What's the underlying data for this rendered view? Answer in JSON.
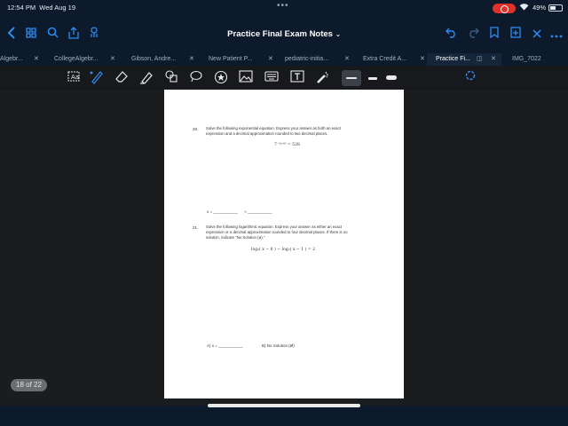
{
  "status": {
    "time": "12:54 PM",
    "date": "Wed Aug 19",
    "battery_pct": "49%",
    "battery_level": 0.49,
    "recording": true
  },
  "navbar": {
    "title": "Practice Final Exam Notes",
    "left_icons": [
      "back-icon",
      "grid-icon",
      "search-icon",
      "share-icon",
      "bookmark-tag-icon"
    ],
    "right_icons": [
      "undo-icon",
      "redo-icon",
      "bookmark-icon",
      "export-icon",
      "close-icon",
      "more-icon"
    ]
  },
  "tabs": [
    {
      "label": "Algebr...",
      "active": false
    },
    {
      "label": "CollegeAlgebr...",
      "active": false
    },
    {
      "label": "Gibson, Andre...",
      "active": false
    },
    {
      "label": "New Patient P...",
      "active": false
    },
    {
      "label": "pediatric-initia...",
      "active": false
    },
    {
      "label": "Extra Credit A...",
      "active": false
    },
    {
      "label": "Practice Fi...",
      "active": true
    },
    {
      "label": "IMG_7022",
      "active": false
    }
  ],
  "toolbar": {
    "tools": [
      "lasso-text-icon",
      "pen-icon",
      "eraser-icon",
      "highlighter-icon",
      "shapes-icon",
      "lasso-icon",
      "sticker-icon",
      "image-icon",
      "keyboard-icon",
      "text-icon",
      "laser-pointer-icon"
    ],
    "selected_tool": "pen-icon",
    "accent": "#2d8cf0"
  },
  "page": {
    "q20": {
      "number": "20.",
      "text_line1": "Solve the following exponential equation.  Express your answer as both an exact",
      "text_line2": "expression and a decimal approximation rounded to two decimal places.",
      "equation": "7⁻³ˣ⁺⁸ = 528",
      "answer": "x = ___________      ≈ ___________"
    },
    "q21": {
      "number": "21.",
      "text_line1": "Solve the following logarithmic equation.  Express your answer as either an exact",
      "text_line2": "expression or a decimal approximation rounded to four decimal places.  If there is no",
      "text_line3": "solution, indicate \"No Solution (ø).\"",
      "equation": "log₂( x − 6 ) − log₂( x − 1 ) = 2",
      "answer_a": "A) x = ___________",
      "answer_b": "B) No Solution (Ø)"
    }
  },
  "page_indicator": "18 of 22"
}
